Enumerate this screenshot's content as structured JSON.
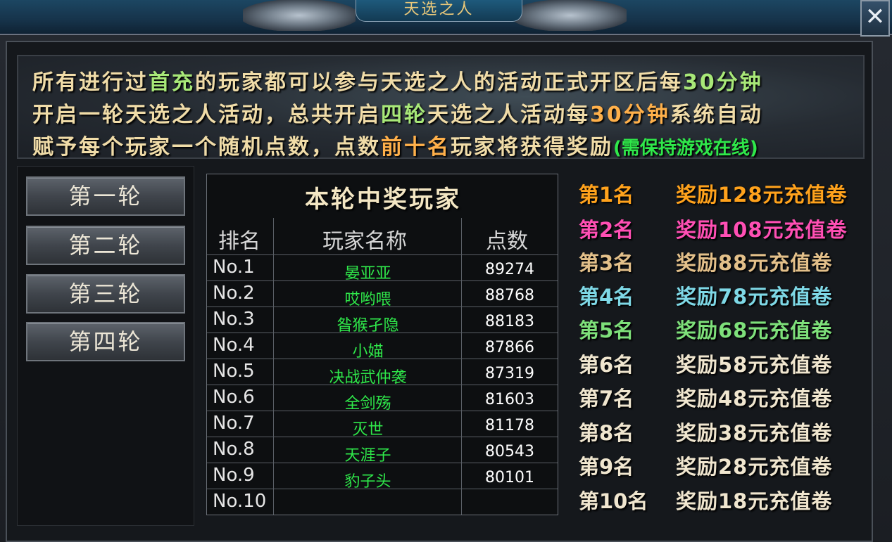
{
  "window": {
    "title": "天选之人",
    "close_label": "✕"
  },
  "banner": {
    "line1": [
      {
        "text": "所有进行过",
        "color": "cream"
      },
      {
        "text": "首充",
        "color": "green"
      },
      {
        "text": "的玩家都可以参与天选之人的活动正式开区后每",
        "color": "cream"
      },
      {
        "text": "30分钟",
        "color": "green"
      }
    ],
    "line2": [
      {
        "text": "开启一轮天选之人活动，总共开启",
        "color": "cream"
      },
      {
        "text": "四轮",
        "color": "green"
      },
      {
        "text": "天选之人活动每",
        "color": "cream"
      },
      {
        "text": "30分钟",
        "color": "orange"
      },
      {
        "text": "系统自动",
        "color": "cream"
      }
    ],
    "line3": [
      {
        "text": "赋予每个玩家一个随机点数，点数",
        "color": "cream"
      },
      {
        "text": "前十名",
        "color": "orange"
      },
      {
        "text": "玩家将获得奖励",
        "color": "cream"
      },
      {
        "text": "(需保持游戏在线)",
        "color": "bright"
      }
    ]
  },
  "rounds": [
    "第一轮",
    "第二轮",
    "第三轮",
    "第四轮"
  ],
  "table": {
    "title": "本轮中奖玩家",
    "headers": [
      "排名",
      "玩家名称",
      "点数"
    ],
    "rows": [
      {
        "rank": "No.1",
        "name": "晏亚亚",
        "score": "89274"
      },
      {
        "rank": "No.2",
        "name": "哎哟喂",
        "score": "88768"
      },
      {
        "rank": "No.3",
        "name": "昝猴孑隐",
        "score": "88183"
      },
      {
        "rank": "No.4",
        "name": "小媌",
        "score": "87866"
      },
      {
        "rank": "No.5",
        "name": "决战武仲袭",
        "score": "87319"
      },
      {
        "rank": "No.6",
        "name": "全剑殇",
        "score": "81603"
      },
      {
        "rank": "No.7",
        "name": "灭世",
        "score": "81178"
      },
      {
        "rank": "No.8",
        "name": "天涯子",
        "score": "80543"
      },
      {
        "rank": "No.9",
        "name": "豹子头",
        "score": "80101"
      },
      {
        "rank": "No.10",
        "name": "",
        "score": ""
      }
    ]
  },
  "rewards": [
    {
      "rank": "第1名",
      "text": "奖励128元充值卷",
      "color": "#ffa21c"
    },
    {
      "rank": "第2名",
      "text": "奖励108元充值卷",
      "color": "#ff4fb4"
    },
    {
      "rank": "第3名",
      "text": "奖励88元充值卷",
      "color": "#e3c08a"
    },
    {
      "rank": "第4名",
      "text": "奖励78元充值卷",
      "color": "#7ed8e6"
    },
    {
      "rank": "第5名",
      "text": "奖励68元充值卷",
      "color": "#7ee07a"
    },
    {
      "rank": "第6名",
      "text": "奖励58元充值卷",
      "color": "#f0e6cf"
    },
    {
      "rank": "第7名",
      "text": "奖励48元充值卷",
      "color": "#f0e6cf"
    },
    {
      "rank": "第8名",
      "text": "奖励38元充值卷",
      "color": "#f0e6cf"
    },
    {
      "rank": "第9名",
      "text": "奖励28元充值卷",
      "color": "#f0e6cf"
    },
    {
      "rank": "第10名",
      "text": "奖励18元充值卷",
      "color": "#f0e6cf"
    }
  ]
}
